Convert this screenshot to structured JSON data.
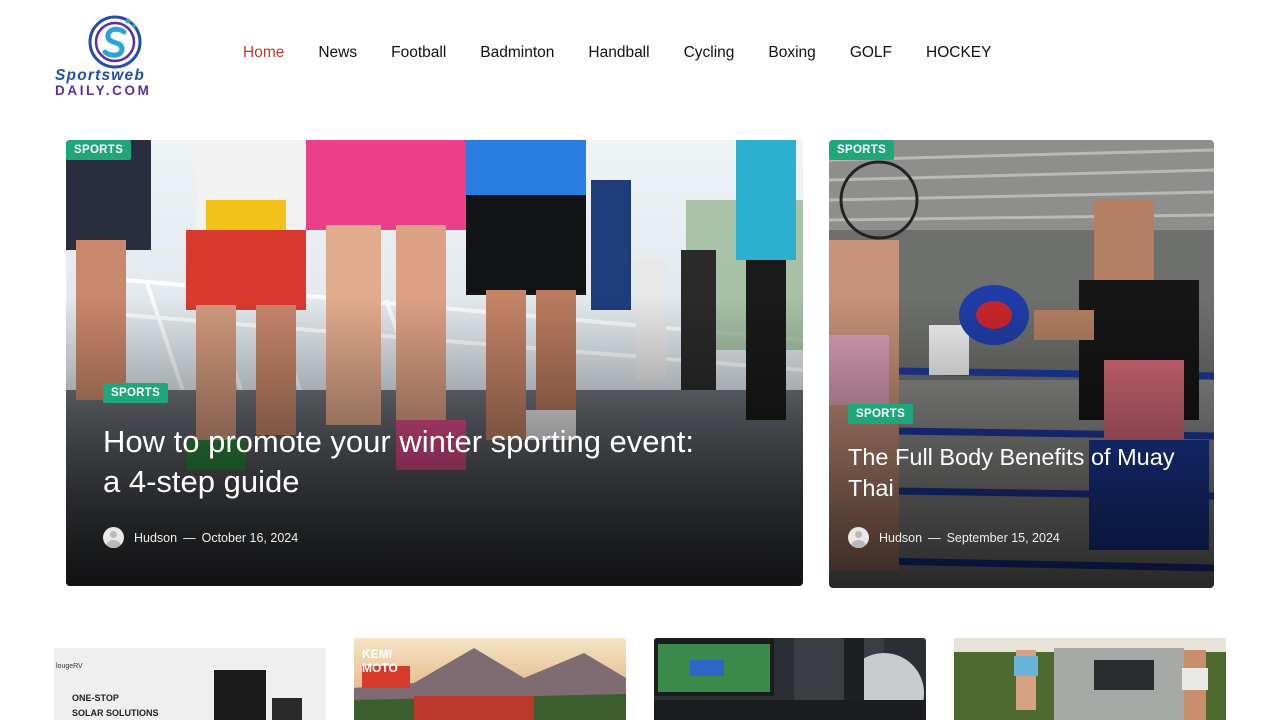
{
  "site": {
    "logo_line1": "Sportsweb",
    "logo_line2": "DAILY.COM",
    "logo_icon": "sports-s-logo-icon"
  },
  "nav": {
    "items": [
      "Home",
      "News",
      "Football",
      "Badminton",
      "Handball",
      "Cycling",
      "Boxing",
      "GOLF",
      "HOCKEY"
    ],
    "active": "Home"
  },
  "featured": [
    {
      "top_badge": "SPORTS",
      "badge": "SPORTS",
      "title": "How to promote your winter sporting event: a 4-step guide",
      "author": "Hudson",
      "separator": "—",
      "date": "October 16, 2024"
    },
    {
      "top_badge": "SPORTS",
      "badge": "SPORTS",
      "title": "The Full Body Benefits of Muay Thai",
      "author": "Hudson",
      "separator": "—",
      "date": "September 15, 2024"
    }
  ],
  "thumbnails": [
    {
      "brand": "lougeRV",
      "caption_line1": "ONE-STOP",
      "caption_line2": "SOLAR SOLUTIONS"
    },
    {
      "brand_line1": "KEMI",
      "brand_line2": "MOTO"
    },
    {
      "scene": "esports-setup"
    },
    {
      "scene": "camping-truck"
    }
  ],
  "colors": {
    "accent": "#c0392b",
    "badge": "#1fa67a"
  }
}
